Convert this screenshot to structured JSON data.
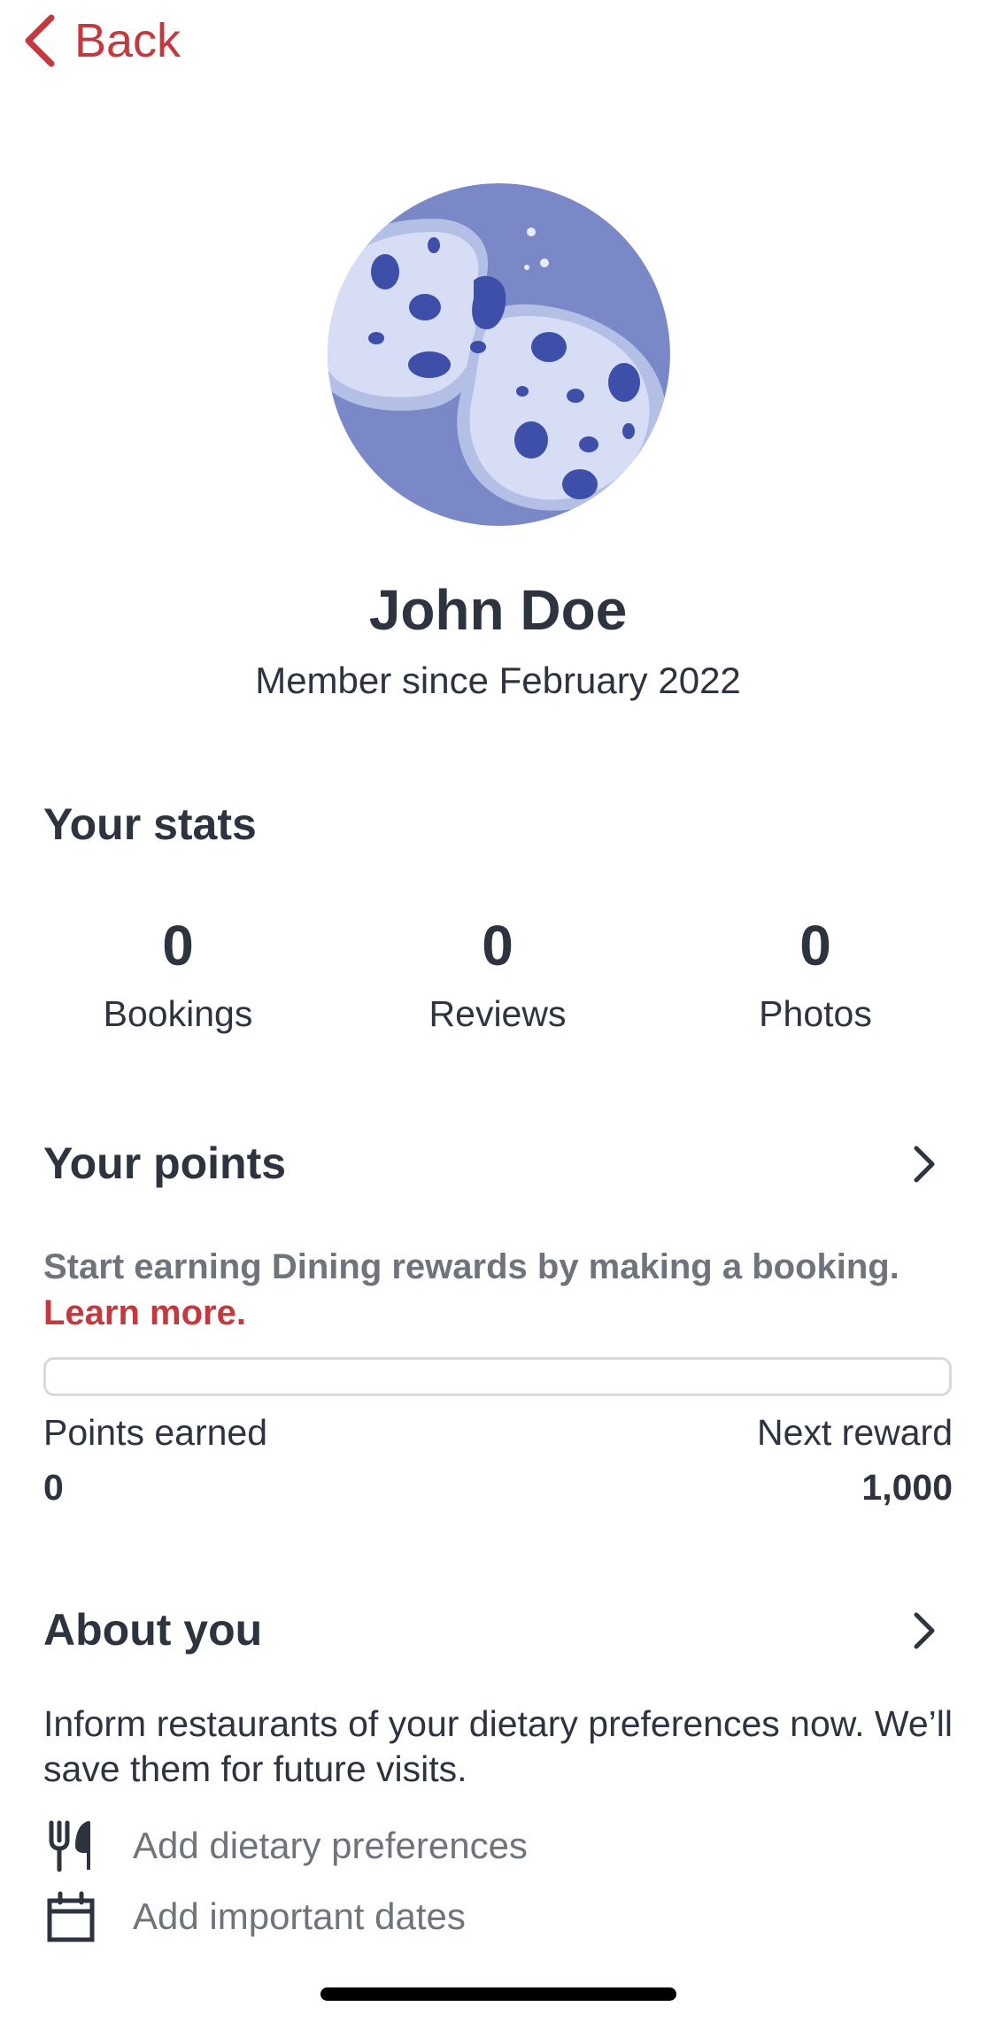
{
  "nav": {
    "back_label": "Back"
  },
  "profile": {
    "name": "John Doe",
    "member_since": "Member since February 2022"
  },
  "stats": {
    "title": "Your stats",
    "items": [
      {
        "value": "0",
        "label": "Bookings"
      },
      {
        "value": "0",
        "label": "Reviews"
      },
      {
        "value": "0",
        "label": "Photos"
      }
    ]
  },
  "points": {
    "title": "Your points",
    "promo_text": "Start earning Dining rewards by making a booking.",
    "learn_more": "Learn more.",
    "progress_percent": 0,
    "earned_label": "Points earned",
    "earned_value": "0",
    "next_label": "Next reward",
    "next_value": "1,000"
  },
  "about": {
    "title": "About you",
    "description": "Inform restaurants of your dietary preferences now. We’ll save them for future visits.",
    "actions": [
      {
        "label": "Add dietary preferences",
        "icon": "fork-knife-icon"
      },
      {
        "label": "Add important dates",
        "icon": "calendar-icon"
      }
    ]
  },
  "colors": {
    "accent": "#c4393d",
    "text": "#2d333f",
    "muted": "#6f737b",
    "avatar_bg": "#7a88c8"
  }
}
